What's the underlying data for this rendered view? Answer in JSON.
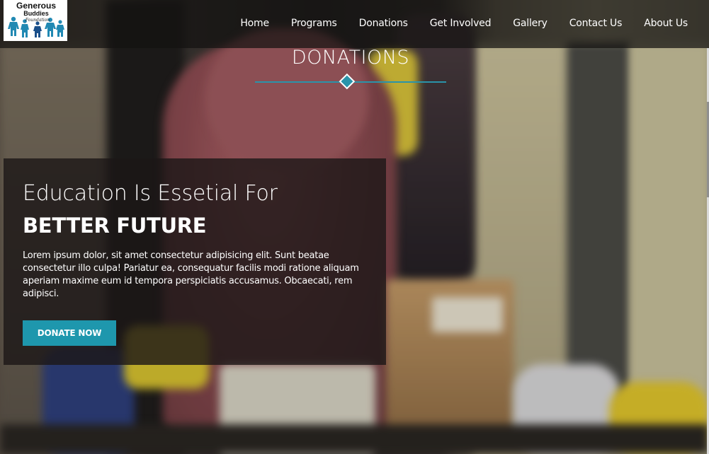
{
  "header": {
    "logo_text_line1": "Generous",
    "logo_text_line2": "Buddies",
    "logo_text_line3": "Foundation",
    "nav": [
      {
        "label": "Home"
      },
      {
        "label": "Programs"
      },
      {
        "label": "Donations"
      },
      {
        "label": "Get Involved"
      },
      {
        "label": "Gallery"
      },
      {
        "label": "Contact Us"
      },
      {
        "label": "About Us"
      }
    ]
  },
  "section": {
    "title": "DONATIONS",
    "accent_color": "#2a94aa"
  },
  "hero": {
    "line1": "Education Is Essetial For",
    "line2": "BETTER FUTURE",
    "description": "Lorem ipsum dolor, sit amet consectetur adipisicing elit. Sunt beatae consectetur illo culpa! Pariatur ea, consequatur facilis modi ratione aliquam aperiam maxime eum id tempora perspiciatis accusamus. Obcaecati, rem adipisci.",
    "button_label": "DONATE NOW",
    "button_color": "#1e97ad"
  },
  "icons": {
    "divider_ornament": "diamond-icon"
  }
}
